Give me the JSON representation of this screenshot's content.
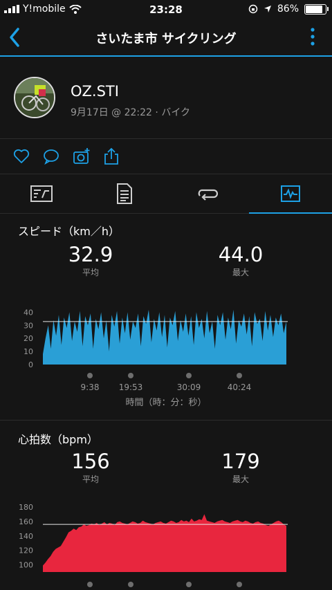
{
  "status_bar": {
    "carrier": "Y!mobile",
    "time": "23:28",
    "battery": "86%",
    "battery_level": 0.86
  },
  "nav": {
    "title": "さいたま市 サイクリング"
  },
  "profile": {
    "name": "OZ.STI",
    "meta": "9月17日 @ 22:22 · バイク"
  },
  "speed": {
    "title": "スピード（km／h）",
    "avg_value": "32.9",
    "avg_label": "平均",
    "max_value": "44.0",
    "max_label": "最大",
    "x_axis_label": "時間（時：分：秒）"
  },
  "heart": {
    "title": "心拍数（bpm）",
    "avg_value": "156",
    "avg_label": "平均",
    "max_value": "179",
    "max_label": "最大"
  },
  "colors": {
    "accent": "#1da1e6",
    "speed_fill": "#2a9fd6",
    "heart_fill": "#e8263e"
  },
  "chart_data": [
    {
      "type": "area",
      "ylim": [
        0,
        45
      ],
      "y_ticks": [
        "0",
        "10",
        "20",
        "30",
        "40"
      ],
      "x_ticks": [
        "9:38",
        "19:53",
        "30:09",
        "40:24"
      ],
      "xlabel": "時間（時：分：秒）",
      "average_line": 32.9,
      "values": [
        8,
        20,
        30,
        12,
        34,
        22,
        38,
        15,
        36,
        28,
        40,
        18,
        33,
        25,
        41,
        14,
        37,
        30,
        39,
        12,
        35,
        27,
        40,
        20,
        34,
        10,
        38,
        29,
        41,
        16,
        36,
        24,
        40,
        19,
        33,
        28,
        39,
        14,
        37,
        31,
        42,
        17,
        35,
        26,
        40,
        21,
        38,
        13,
        36,
        30,
        41,
        18,
        34,
        25,
        39,
        22,
        37,
        15,
        40,
        28,
        35,
        20,
        41,
        24,
        33,
        12,
        38,
        30,
        40,
        19,
        36,
        27,
        42,
        16,
        34,
        29,
        39,
        23,
        37,
        14,
        40,
        31,
        35,
        18,
        41,
        26,
        38,
        21,
        36,
        30,
        39,
        24,
        33
      ]
    },
    {
      "type": "area",
      "ylim": [
        90,
        180
      ],
      "y_ticks": [
        "100",
        "120",
        "140",
        "160",
        "180"
      ],
      "average_line": 156,
      "values": [
        99,
        103,
        108,
        112,
        118,
        122,
        124,
        126,
        132,
        138,
        145,
        147,
        150,
        148,
        152,
        153,
        156,
        154,
        155,
        157,
        156,
        158,
        155,
        157,
        159,
        156,
        158,
        157,
        155,
        159,
        160,
        158,
        157,
        156,
        158,
        160,
        159,
        157,
        158,
        161,
        159,
        158,
        157,
        156,
        158,
        159,
        160,
        158,
        157,
        159,
        161,
        160,
        158,
        159,
        162,
        160,
        161,
        159,
        164,
        160,
        161,
        163,
        162,
        170,
        161,
        160,
        159,
        158,
        160,
        161,
        162,
        160,
        159,
        158,
        160,
        161,
        162,
        160,
        159,
        161,
        160,
        158,
        157,
        159,
        160,
        158,
        157,
        155,
        154,
        156,
        158,
        160,
        161,
        159,
        156,
        154
      ]
    }
  ]
}
